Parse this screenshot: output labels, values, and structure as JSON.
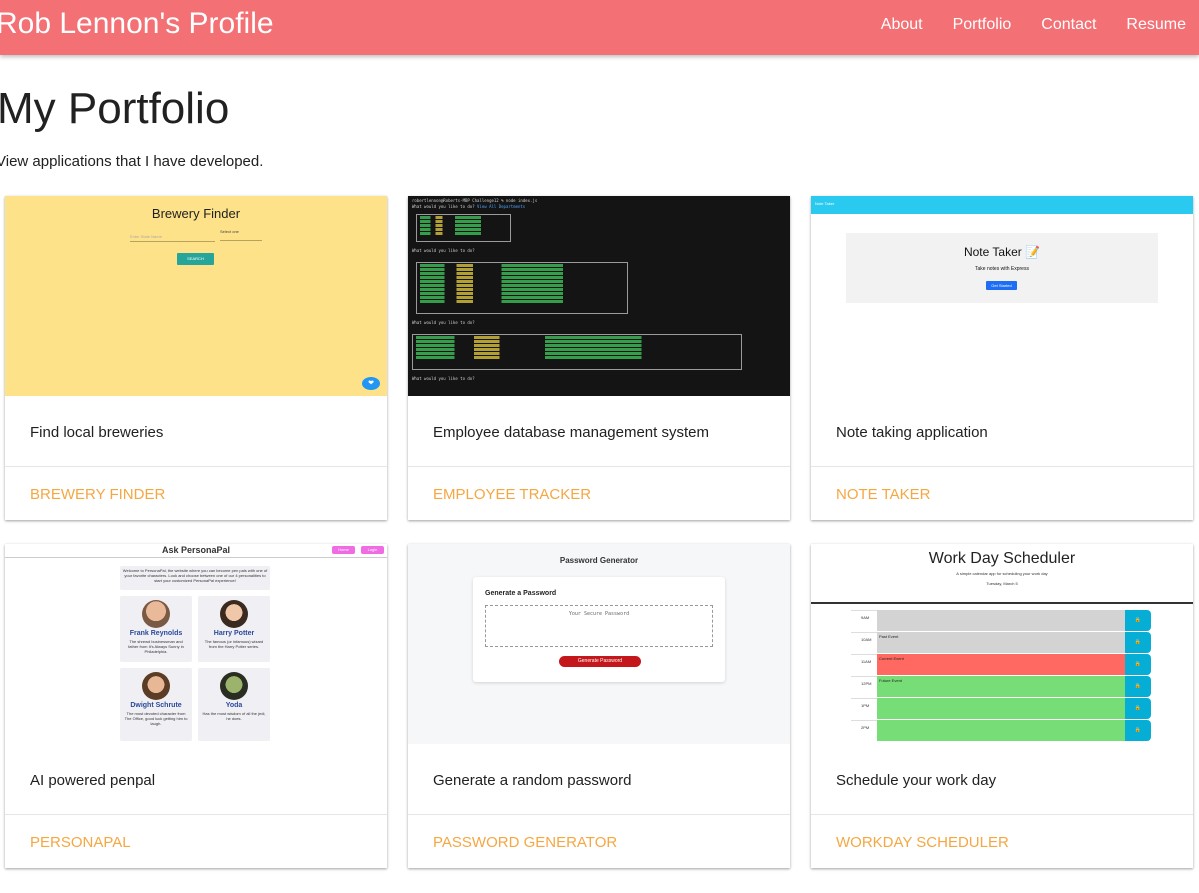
{
  "nav": {
    "brand": "Rob Lennon's Profile",
    "links": [
      "About",
      "Portfolio",
      "Contact",
      "Resume"
    ]
  },
  "page": {
    "title": "My Portfolio",
    "subtitle": "View applications that I have developed."
  },
  "projects": [
    {
      "description": "Find local breweries",
      "action": "BREWERY FINDER",
      "thumb": {
        "title": "Brewery Finder",
        "placeholder": "Enter State Name",
        "select_label": "Select one",
        "button": "SEARCH"
      }
    },
    {
      "description": "Employee database management system",
      "action": "EMPLOYEE TRACKER",
      "thumb": {
        "prompt": "What would you like to do?",
        "answer": "View All Departments"
      }
    },
    {
      "description": "Note taking application",
      "action": "NOTE TAKER",
      "thumb": {
        "bar": "Note Taker",
        "title": "Note Taker 📝",
        "subtitle": "Take notes with Express",
        "button": "Get Started"
      }
    },
    {
      "description": "AI powered penpal",
      "action": "PERSONAPAL",
      "thumb": {
        "title": "Ask PersonaPal",
        "btn1": "Home",
        "btn2": "Login",
        "intro": "Welcome to PersonaPal, the website where you can become pen pals with one of your favorite characters. Look and choose between one of our 4 personalities to start your customized PersonaPal experience!",
        "people": [
          {
            "name": "Frank Reynolds",
            "desc": "The shrewd businessman and father from It's Always Sunny in Philadelphia."
          },
          {
            "name": "Harry Potter",
            "desc": "The famous (or infamous) wizard from the Harry Potter series."
          },
          {
            "name": "Dwight Schrute",
            "desc": "The most devoted character from The Office, good luck getting him to laugh."
          },
          {
            "name": "Yoda",
            "desc": "Has the most wisdom of all the jedi, he does."
          }
        ]
      }
    },
    {
      "description": "Generate a random password",
      "action": "PASSWORD GENERATOR",
      "thumb": {
        "title": "Password Generator",
        "header": "Generate a Password",
        "placeholder": "Your Secure Password",
        "button": "Generate Password"
      }
    },
    {
      "description": "Schedule your work day",
      "action": "WORKDAY SCHEDULER",
      "thumb": {
        "title": "Work Day Scheduler",
        "subtitle": "A simple calendar app for scheduling your work day",
        "date": "Tuesday, March 5",
        "hours": [
          "9AM",
          "10AM",
          "11AM",
          "12PM",
          "1PM",
          "2PM"
        ],
        "events": [
          "",
          "Past Event",
          "Current Event",
          "Future Event",
          "",
          ""
        ]
      }
    }
  ],
  "colors": {
    "nav_bg": "#f37075",
    "action_link": "#f5a742",
    "brewery_bg": "#fde289",
    "past": "#d3d3d3",
    "present": "#ff6961",
    "future": "#77dd77",
    "save_button": "#06aed5"
  },
  "icons": {
    "brewery_fab": "heart-icon",
    "save": "lock-icon"
  }
}
